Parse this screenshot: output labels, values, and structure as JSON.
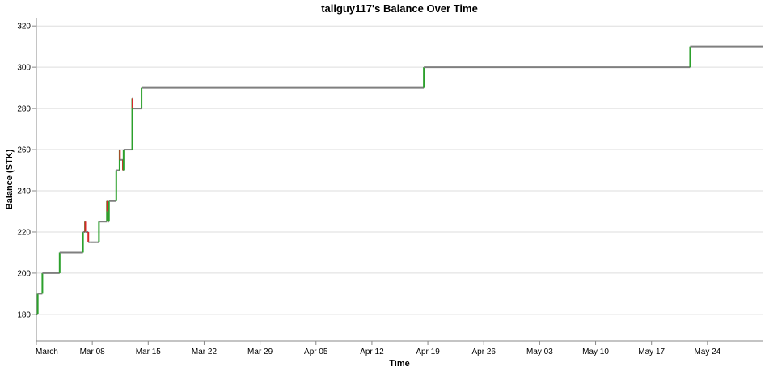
{
  "chart_data": {
    "type": "line",
    "title": "tallguy117's Balance Over Time",
    "xlabel": "Time",
    "ylabel": "Balance (STK)",
    "x_axis": {
      "type": "time",
      "range": [
        "2021-03-01",
        "2021-05-31"
      ],
      "tick_labels": [
        "March",
        "Mar 08",
        "Mar 15",
        "Mar 22",
        "Mar 29",
        "Apr 05",
        "Apr 12",
        "Apr 19",
        "Apr 26",
        "May 03",
        "May 10",
        "May 17",
        "May 24"
      ],
      "tick_dates": [
        "2021-03-01",
        "2021-03-08",
        "2021-03-15",
        "2021-03-22",
        "2021-03-29",
        "2021-04-05",
        "2021-04-12",
        "2021-04-19",
        "2021-04-26",
        "2021-05-03",
        "2021-05-10",
        "2021-05-17",
        "2021-05-24"
      ]
    },
    "y_axis": {
      "ylim": [
        167,
        324
      ],
      "ticks": [
        180,
        200,
        220,
        240,
        260,
        280,
        300,
        320
      ]
    },
    "grid": true,
    "colors": {
      "increase": "#2ca02c",
      "decrease": "#d62728",
      "flat": "#7f7f7f"
    },
    "points": [
      {
        "t": "2021-03-01T00:00",
        "y": 180
      },
      {
        "t": "2021-03-01T04:00",
        "y": 190
      },
      {
        "t": "2021-03-01T18:00",
        "y": 200
      },
      {
        "t": "2021-03-03T22:00",
        "y": 210
      },
      {
        "t": "2021-03-06T20:00",
        "y": 220
      },
      {
        "t": "2021-03-07T02:00",
        "y": 225
      },
      {
        "t": "2021-03-07T03:00",
        "y": 220
      },
      {
        "t": "2021-03-07T12:00",
        "y": 215
      },
      {
        "t": "2021-03-07T18:00",
        "y": 215
      },
      {
        "t": "2021-03-08T07:00",
        "y": 215
      },
      {
        "t": "2021-03-08T12:00",
        "y": 215
      },
      {
        "t": "2021-03-08T20:00",
        "y": 225
      },
      {
        "t": "2021-03-09T20:00",
        "y": 235
      },
      {
        "t": "2021-03-09T21:00",
        "y": 230
      },
      {
        "t": "2021-03-10T00:00",
        "y": 225
      },
      {
        "t": "2021-03-10T02:00",
        "y": 235
      },
      {
        "t": "2021-03-11T00:00",
        "y": 250
      },
      {
        "t": "2021-03-11T10:00",
        "y": 260
      },
      {
        "t": "2021-03-11T11:00",
        "y": 255
      },
      {
        "t": "2021-03-11T16:00",
        "y": 255
      },
      {
        "t": "2021-03-11T20:00",
        "y": 250
      },
      {
        "t": "2021-03-11T22:00",
        "y": 260
      },
      {
        "t": "2021-03-13T00:00",
        "y": 285
      },
      {
        "t": "2021-03-13T01:00",
        "y": 280
      },
      {
        "t": "2021-03-14T04:00",
        "y": 290
      },
      {
        "t": "2021-04-18T12:00",
        "y": 300
      },
      {
        "t": "2021-05-21T20:00",
        "y": 310
      },
      {
        "t": "2021-05-31T00:00",
        "y": 310
      }
    ]
  }
}
